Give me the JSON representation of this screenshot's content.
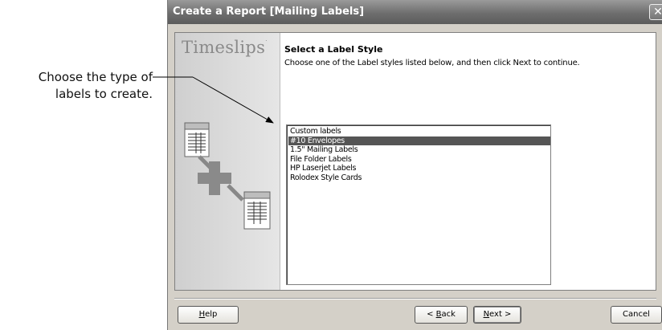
{
  "callout": {
    "line1": "Choose the type of",
    "line2": "labels to create."
  },
  "window": {
    "title": "Create a Report [Mailing Labels]",
    "close_glyph": "✕"
  },
  "sidebar": {
    "logo": "Timeslips",
    "logo_mark": "·"
  },
  "main": {
    "heading": "Select a Label Style",
    "description": "Choose one of the Label styles listed below, and then click Next to continue."
  },
  "label_styles": {
    "items": [
      "Custom labels",
      "#10 Envelopes",
      "1.5\" Mailing Labels",
      "File Folder Labels",
      "HP Laserjet Labels",
      "Rolodex Style Cards"
    ],
    "selected": "#10 Envelopes"
  },
  "buttons": {
    "help": {
      "mnemonic": "H",
      "rest": "elp"
    },
    "back": {
      "prefix": "< ",
      "mnemonic": "B",
      "rest": "ack"
    },
    "next": {
      "mnemonic": "N",
      "rest": "ext >"
    },
    "cancel": {
      "label": "Cancel"
    }
  },
  "colors": {
    "selection": "#555555",
    "titlebar": "#6e6e6e",
    "dialog_bg": "#d4d0c8"
  },
  "icons": [
    "close-icon",
    "report-document-icon",
    "plus-icon",
    "sheet-document-icon"
  ]
}
